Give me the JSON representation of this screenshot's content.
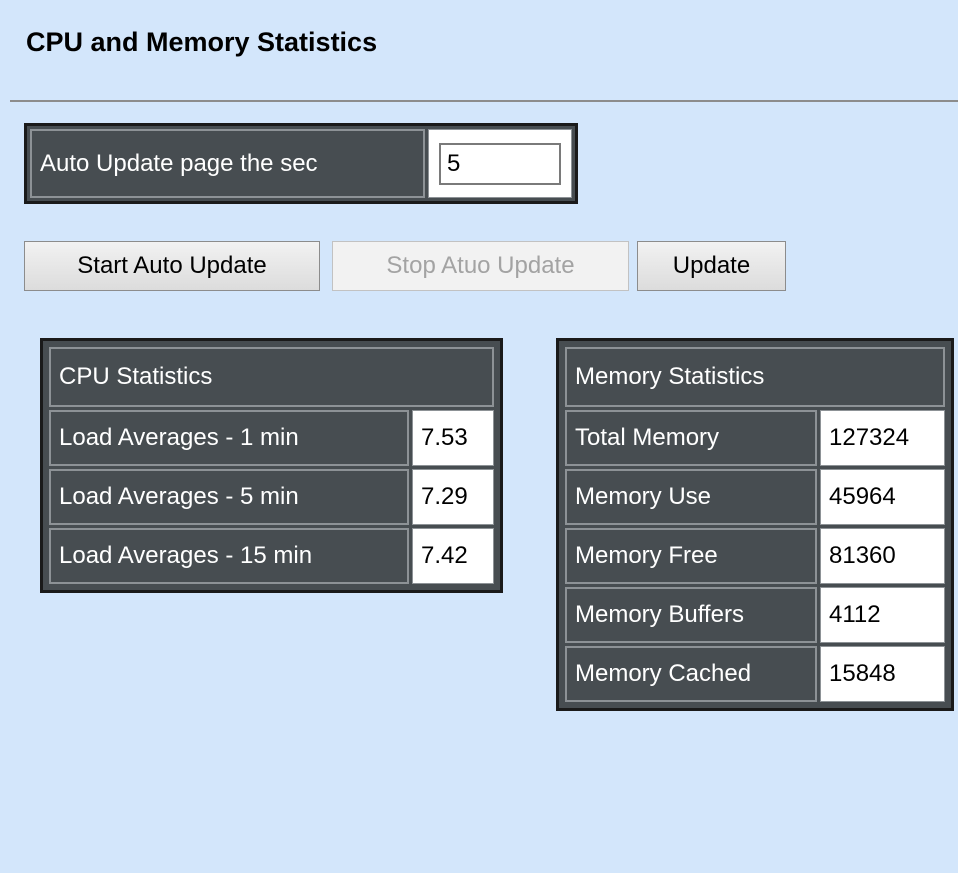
{
  "page": {
    "title": "CPU and Memory Statistics"
  },
  "auto_update": {
    "label": "Auto Update page the sec",
    "value": "5"
  },
  "buttons": {
    "start": "Start Auto Update",
    "stop": "Stop Atuo Update",
    "update": "Update"
  },
  "cpu": {
    "header": "CPU Statistics",
    "rows": [
      {
        "label": "Load Averages - 1 min",
        "value": "7.53"
      },
      {
        "label": "Load Averages - 5 min",
        "value": "7.29"
      },
      {
        "label": "Load Averages - 15 min",
        "value": "7.42"
      }
    ]
  },
  "memory": {
    "header": "Memory Statistics",
    "rows": [
      {
        "label": "Total Memory",
        "value": "127324"
      },
      {
        "label": "Memory Use",
        "value": "45964"
      },
      {
        "label": "Memory Free",
        "value": "81360"
      },
      {
        "label": "Memory Buffers",
        "value": "4112"
      },
      {
        "label": "Memory Cached",
        "value": "15848"
      }
    ]
  },
  "colors": {
    "page_background": "#d3e6fb",
    "table_header": "#474d51",
    "table_border": "#1a1a1a"
  }
}
